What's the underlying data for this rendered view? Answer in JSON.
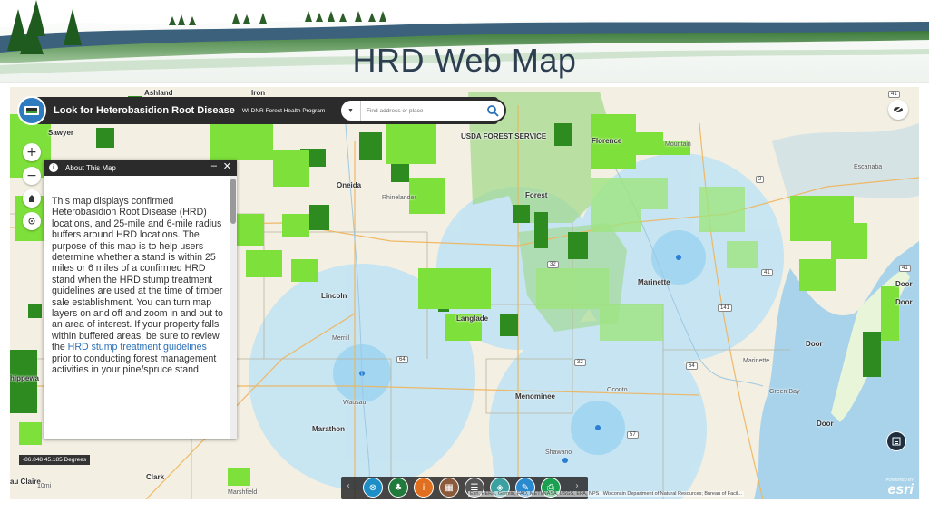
{
  "slide": {
    "title": "HRD Web Map"
  },
  "app": {
    "title": "Look for Heterobasidion Root Disease",
    "subtitle": "WI DNR Forest Health Program",
    "search_placeholder": "Find address or place"
  },
  "panel": {
    "title": "About This Map",
    "minimize": "–",
    "close": "✕",
    "body_text": "This map displays confirmed Heterobasidion Root Disease (HRD) locations, and 25-mile and 6-mile radius buffers around HRD locations.  The purpose of this map is to help users determine whether a stand is within 25 miles or 6 miles of a confirmed HRD stand when the HRD stump treatment guidelines are used at the time of timber sale establishment.  You can turn map layers on and off and zoom in and out to an area of interest.  If your property falls within buffered areas, be sure to review the ",
    "link_text": "HRD stump treatment guidelines",
    "body_end": " prior to conducting forest management activities in your pine/spruce stand."
  },
  "tools": {
    "zoom_in": "+",
    "zoom_out": "−"
  },
  "coords": "-86.848 45.185 Degrees",
  "attribution": "Esri, HERE, Garmin, FAO, METI/NASA, USGS, EPA, NPS | Wisconsin Department of Natural Resources; Bureau of Facil...",
  "esri": {
    "powered": "POWERED BY",
    "logo": "esri"
  },
  "places": {
    "ashland": "Ashland",
    "iron": "Iron",
    "sawyer": "Sawyer",
    "usfs": "USDA FOREST SERVICE",
    "florence": "Florence",
    "mountain": "Mountain",
    "escanaba": "Escanaba",
    "oneida": "Oneida",
    "rhinelander": "Rhinelander",
    "forest": "Forest",
    "lincoln": "Lincoln",
    "langlade": "Langlade",
    "marinette": "Marinette",
    "marinette2": "Marinette",
    "door1": "Door",
    "door2": "Door",
    "door3": "Door",
    "door4": "Door",
    "chippewa": "hippewa",
    "wausau": "Wausau",
    "marathon": "Marathon",
    "menominee": "Menominee",
    "oconto": "Oconto",
    "shawano": "Shawano",
    "clark": "Clark",
    "marshfield": "Marshfield",
    "eauclaire": "au Claire",
    "merrill": "Merrill",
    "green_bay": "Green Bay",
    "tenmi": "10mi"
  },
  "shields": [
    "41",
    "2",
    "41",
    "141",
    "41",
    "64",
    "64",
    "57",
    "32",
    "32"
  ],
  "colors": {
    "banner_sky": "#ffffff",
    "forest_dark": "#2e8b1f",
    "forest_light": "#7ee03a",
    "buffer_25": "#bfe3f5",
    "buffer_6": "#9ed4f0",
    "water": "#a9d3ea",
    "land": "#f3efe2"
  }
}
